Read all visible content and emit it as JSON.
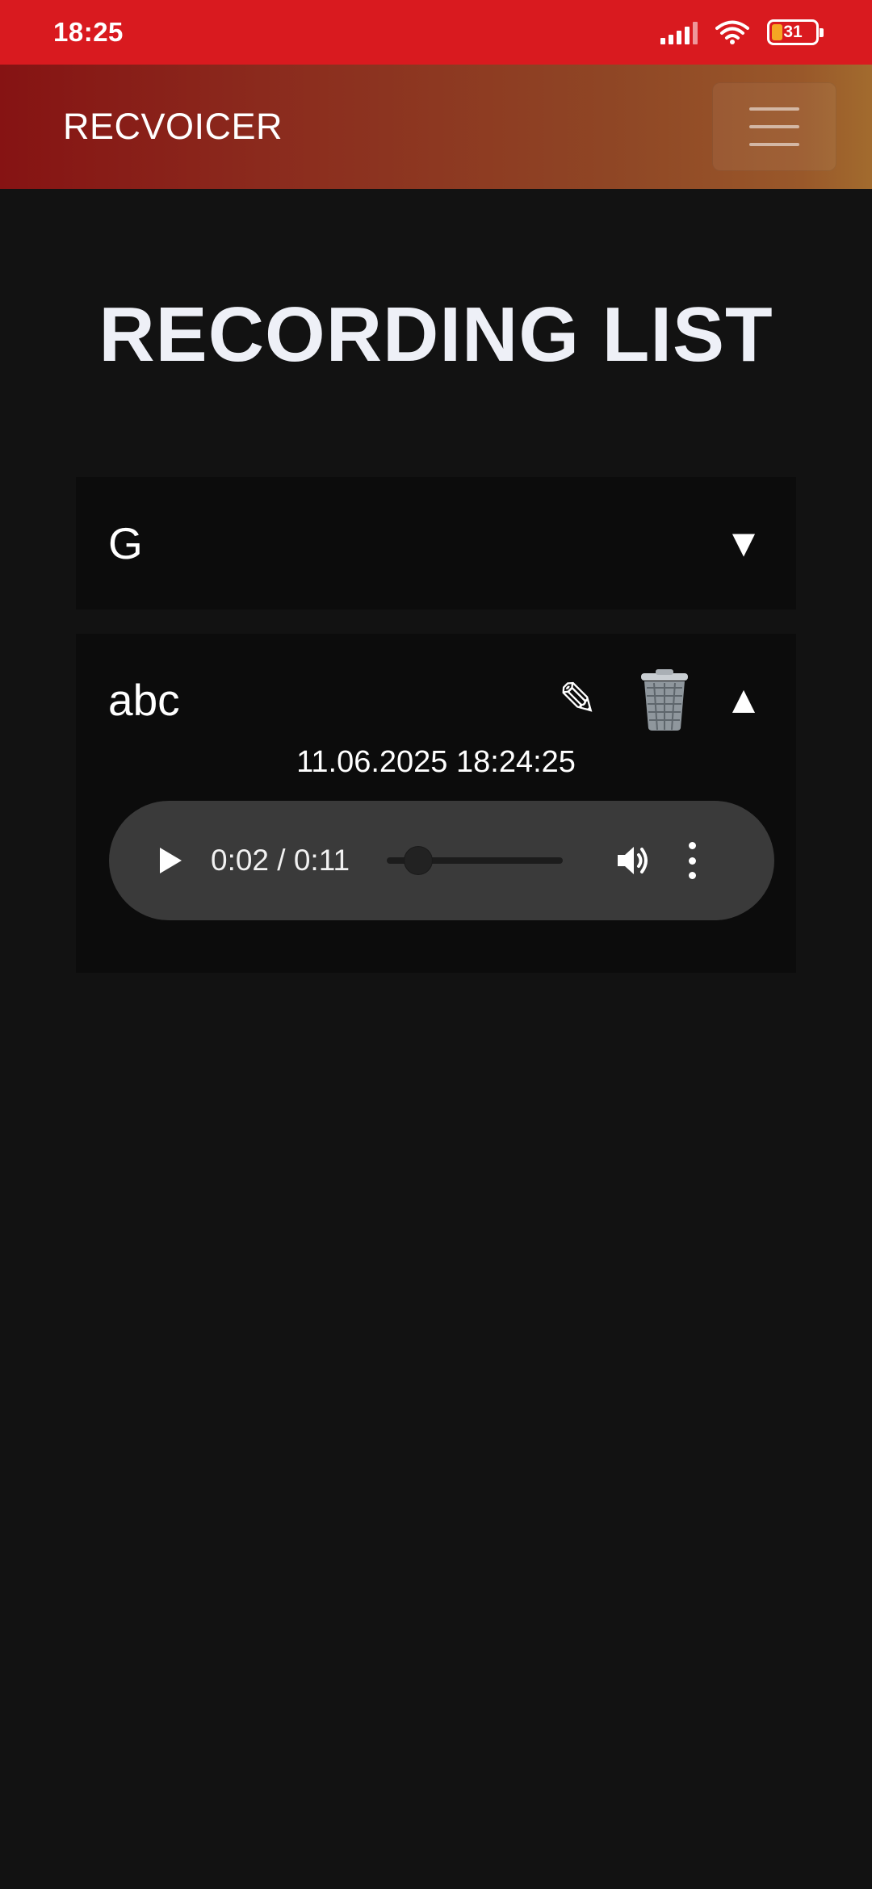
{
  "status_bar": {
    "time": "18:25",
    "battery_level": "31",
    "icons": [
      "signal-icon",
      "wifi-icon",
      "battery-icon"
    ]
  },
  "app_bar": {
    "brand": "RECVOICER",
    "menu_icon": "hamburger-menu-icon"
  },
  "page": {
    "title": "RECORDING LIST"
  },
  "recordings": [
    {
      "name": "G",
      "toggle": "▼",
      "expanded": false
    },
    {
      "name": "abc",
      "toggle": "▲",
      "expanded": true,
      "edit_icon": "✎",
      "date": "11.06.2025 18:24:25",
      "player": {
        "time_display": "0:02 / 0:11",
        "progress_fraction": 0.18
      }
    }
  ],
  "colors": {
    "status_bar": "#d91a1f",
    "app_bar_start": "#861313",
    "app_bar_end": "#a26b2e",
    "background": "#121212",
    "card": "#0c0c0c",
    "player": "#3a3a3a"
  }
}
